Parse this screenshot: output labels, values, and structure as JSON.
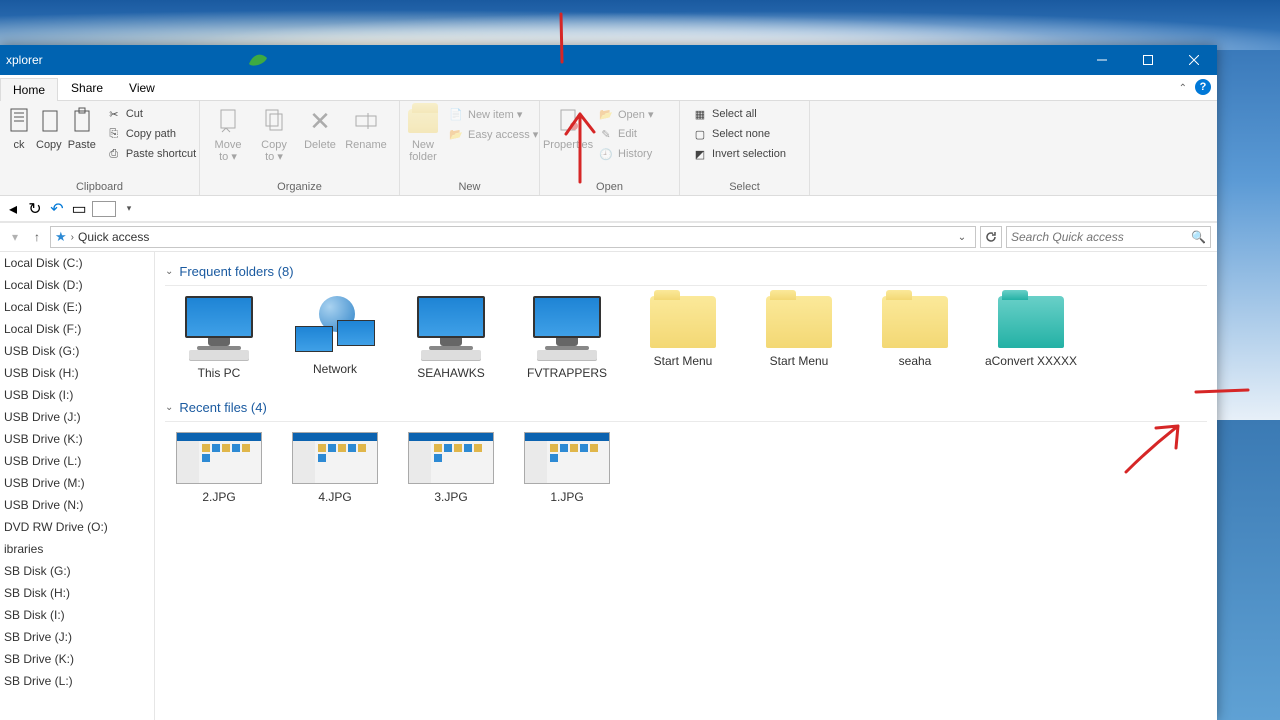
{
  "window": {
    "title_fragment": "xplorer"
  },
  "tabs": {
    "home": "Home",
    "share": "Share",
    "view": "View"
  },
  "ribbon": {
    "clipboard": {
      "label": "Clipboard",
      "big": [
        {
          "label": "ck"
        },
        {
          "label": "Copy"
        },
        {
          "label": "Paste"
        }
      ],
      "small": [
        "Cut",
        "Copy path",
        "Paste shortcut"
      ]
    },
    "organize": {
      "label": "Organize",
      "big": [
        {
          "label": "Move\nto ▾"
        },
        {
          "label": "Copy\nto ▾"
        },
        {
          "label": "Delete"
        },
        {
          "label": "Rename"
        }
      ]
    },
    "new": {
      "label": "New",
      "big": [
        {
          "label": "New\nfolder"
        }
      ],
      "small": [
        "New item ▾",
        "Easy access ▾"
      ]
    },
    "open": {
      "label": "Open",
      "big": [
        {
          "label": "Properties"
        }
      ],
      "small": [
        "Open ▾",
        "Edit",
        "History"
      ]
    },
    "select": {
      "label": "Select",
      "small": [
        "Select all",
        "Select none",
        "Invert selection"
      ]
    }
  },
  "address": {
    "location": "Quick access",
    "search_placeholder": "Search Quick access"
  },
  "nav_items": [
    "Local Disk (C:)",
    "Local Disk  (D:)",
    "Local Disk  (E:)",
    "Local Disk  (F:)",
    "USB Disk (G:)",
    "USB Disk (H:)",
    "USB Disk (I:)",
    "USB Drive (J:)",
    "USB Drive (K:)",
    "USB Drive (L:)",
    "USB Drive (M:)",
    "USB Drive (N:)",
    "DVD RW Drive (O:)",
    "ibraries",
    "SB Disk (G:)",
    "SB Disk (H:)",
    "SB Disk (I:)",
    "SB Drive (J:)",
    "SB Drive (K:)",
    "SB Drive (L:)"
  ],
  "groups": {
    "frequent": {
      "title": "Frequent folders (8)",
      "items": [
        {
          "name": "This PC",
          "kind": "pc"
        },
        {
          "name": "Network",
          "kind": "net"
        },
        {
          "name": "SEAHAWKS",
          "kind": "pc"
        },
        {
          "name": "FVTRAPPERS",
          "kind": "pc"
        },
        {
          "name": "Start Menu",
          "kind": "folder"
        },
        {
          "name": "Start Menu",
          "kind": "folder"
        },
        {
          "name": "seaha",
          "kind": "folder"
        },
        {
          "name": "aConvert XXXXX",
          "kind": "folder-teal"
        }
      ]
    },
    "recent": {
      "title": "Recent files (4)",
      "items": [
        {
          "name": "2.JPG"
        },
        {
          "name": "4.JPG"
        },
        {
          "name": "3.JPG"
        },
        {
          "name": "1.JPG"
        }
      ]
    }
  }
}
